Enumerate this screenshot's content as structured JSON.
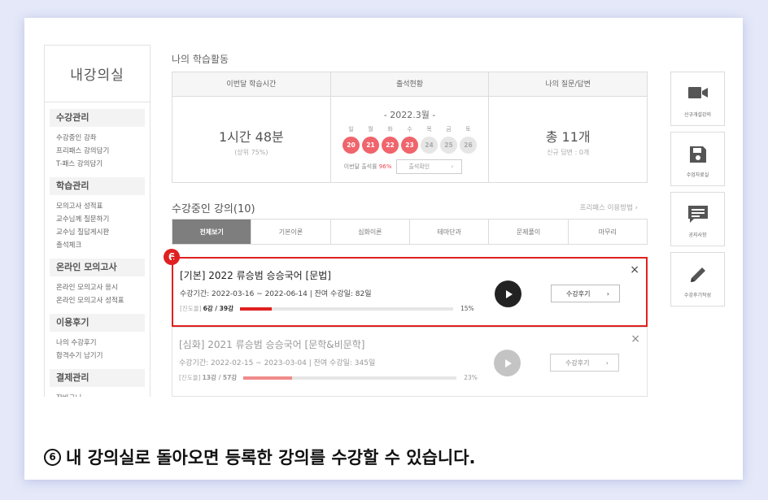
{
  "sidebar": {
    "title": "내강의실",
    "groups": [
      {
        "head": "수강관리",
        "links": [
          "수강중인 강좌",
          "프리패스 강의담기",
          "T-패스 강의담기"
        ]
      },
      {
        "head": "학습관리",
        "links": [
          "모의고사 성적표",
          "교수님께 질문하기",
          "교수님 질답게시판",
          "출석체크"
        ]
      },
      {
        "head": "온라인 모의고사",
        "links": [
          "온라인 모의고사 응시",
          "온라인 모의고사 성적표"
        ]
      },
      {
        "head": "이용후기",
        "links": [
          "나의 수강후기",
          "합격수기 남기기"
        ]
      },
      {
        "head": "결제관리",
        "links": [
          "장바구니",
          "적립금/쿠폰"
        ]
      }
    ]
  },
  "activity": {
    "title": "나의 학습활동",
    "study_time": {
      "head": "이번달 학습시간",
      "value": "1시간 48분",
      "rank": "(상위 75%)"
    },
    "attendance": {
      "head": "출석현황",
      "month": "- 2022.3월 -",
      "weekdays": [
        "일",
        "월",
        "화",
        "수",
        "목",
        "금",
        "토"
      ],
      "days": [
        {
          "d": "20",
          "attended": true
        },
        {
          "d": "21",
          "attended": true
        },
        {
          "d": "22",
          "attended": true
        },
        {
          "d": "23",
          "attended": true
        },
        {
          "d": "24",
          "attended": false
        },
        {
          "d": "25",
          "attended": false
        },
        {
          "d": "26",
          "attended": false
        }
      ],
      "rate_label": "이번달 출석률",
      "rate": "96%",
      "check_button": "출석확인"
    },
    "questions": {
      "head": "나의 질문/답변",
      "total": "총 11개",
      "new_answers": "신규 답변 : 0개"
    }
  },
  "courses": {
    "title": "수강중인 강의(10)",
    "pass_link": "프리패스 이용방법",
    "tabs": [
      "전체보기",
      "기본이론",
      "심화이론",
      "테마단과",
      "문제풀이",
      "마무리"
    ],
    "active_tab": 0,
    "items": [
      {
        "name": "[기본] 2022 류승범 승승국어 [문법]",
        "period": "수강기간: 2022-03-16 ~ 2022-06-14 | 잔여 수강일: 82일",
        "progress_label": "[진도율]",
        "progress_count": "6강 / 39강",
        "progress": 0.15,
        "progress_pct": "15%",
        "review_button": "수강후기",
        "close": "×"
      },
      {
        "name": "[심화] 2021 류승범 승승국어 [문학&비문학]",
        "period": "수강기간: 2022-02-15 ~ 2023-03-04 | 잔여 수강일: 345일",
        "progress_label": "[진도율]",
        "progress_count": "13강 / 57강",
        "progress": 0.23,
        "progress_pct": "23%",
        "review_button": "수강후기",
        "close": "×"
      }
    ]
  },
  "quick_menu": [
    {
      "label": "신규개설강의",
      "icon": "video-camera-icon"
    },
    {
      "label": "수업자료실",
      "icon": "floppy-disk-icon"
    },
    {
      "label": "공지사항",
      "icon": "chat-bubble-icon"
    },
    {
      "label": "수강후기작성",
      "icon": "pencil-icon"
    }
  ],
  "step_badge": "6",
  "caption": {
    "num": "6",
    "text": "내 강의실로 돌아오면 등록한 강의를 수강할 수 있습니다."
  },
  "colors": {
    "accent_red": "#e02020",
    "attended": "#f0646c",
    "not_attended": "#e6e6e6",
    "bar_active": "#e02020",
    "bar_dim": "#f08a8a"
  }
}
